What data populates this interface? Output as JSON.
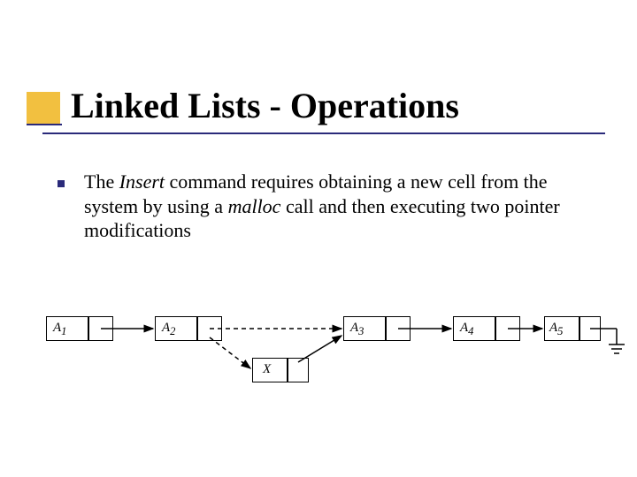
{
  "title": "Linked Lists - Operations",
  "bullet": {
    "pre": "The ",
    "cmd": "Insert",
    "mid": " command requires obtaining a new cell from the system by using a ",
    "malloc": "malloc",
    "post": " call and then executing two pointer modifications"
  },
  "nodes": {
    "a1": {
      "label": "A",
      "sub": "1"
    },
    "a2": {
      "label": "A",
      "sub": "2"
    },
    "a3": {
      "label": "A",
      "sub": "3"
    },
    "a4": {
      "label": "A",
      "sub": "4"
    },
    "a5": {
      "label": "A",
      "sub": "5"
    },
    "x": {
      "label": "X"
    }
  }
}
